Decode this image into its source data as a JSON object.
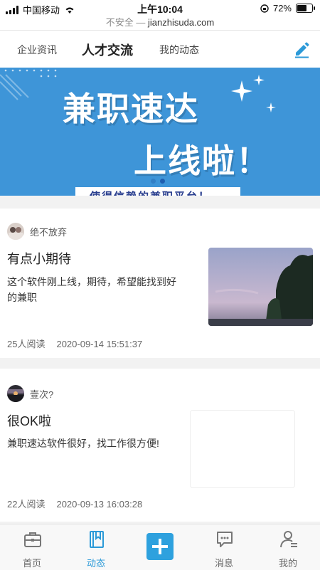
{
  "status_bar": {
    "carrier": "中国移动",
    "time": "上午10:04",
    "battery": "72%",
    "battery_level": 0.72,
    "security": "不安全",
    "separator": " — ",
    "domain": "jianzhisuda.com"
  },
  "top_tabs": {
    "items": [
      {
        "label": "企业资讯",
        "active": false
      },
      {
        "label": "人才交流",
        "active": true
      },
      {
        "label": "我的动态",
        "active": false
      }
    ],
    "edit_icon": "pencil-icon",
    "accent": "#2c9ad8"
  },
  "banner": {
    "line1": "兼职速达",
    "line2": "上线啦！",
    "strip_text": "使得信赖的兼职平台！",
    "background": "#3e95d8",
    "dots": 2,
    "active_dot": 1
  },
  "posts": [
    {
      "author": "绝不放弃",
      "title": "有点小期待",
      "body": "这个软件刚上线，期待，希望能找到好的兼职",
      "reads": "25人阅读",
      "date": "2020-09-14 15:51:37"
    },
    {
      "author": "壹次?",
      "title": "很OK啦",
      "body": "兼职速达软件很好，找工作很方便!",
      "reads": "22人阅读",
      "date": "2020-09-13 16:03:28"
    }
  ],
  "bottom_nav": {
    "items": [
      {
        "label": "首页",
        "icon": "briefcase-icon",
        "active": false
      },
      {
        "label": "动态",
        "icon": "bookmark-book-icon",
        "active": true
      },
      {
        "label": "",
        "icon": "plus-icon",
        "active": false
      },
      {
        "label": "消息",
        "icon": "message-icon",
        "active": false
      },
      {
        "label": "我的",
        "icon": "user-icon",
        "active": false
      }
    ]
  }
}
